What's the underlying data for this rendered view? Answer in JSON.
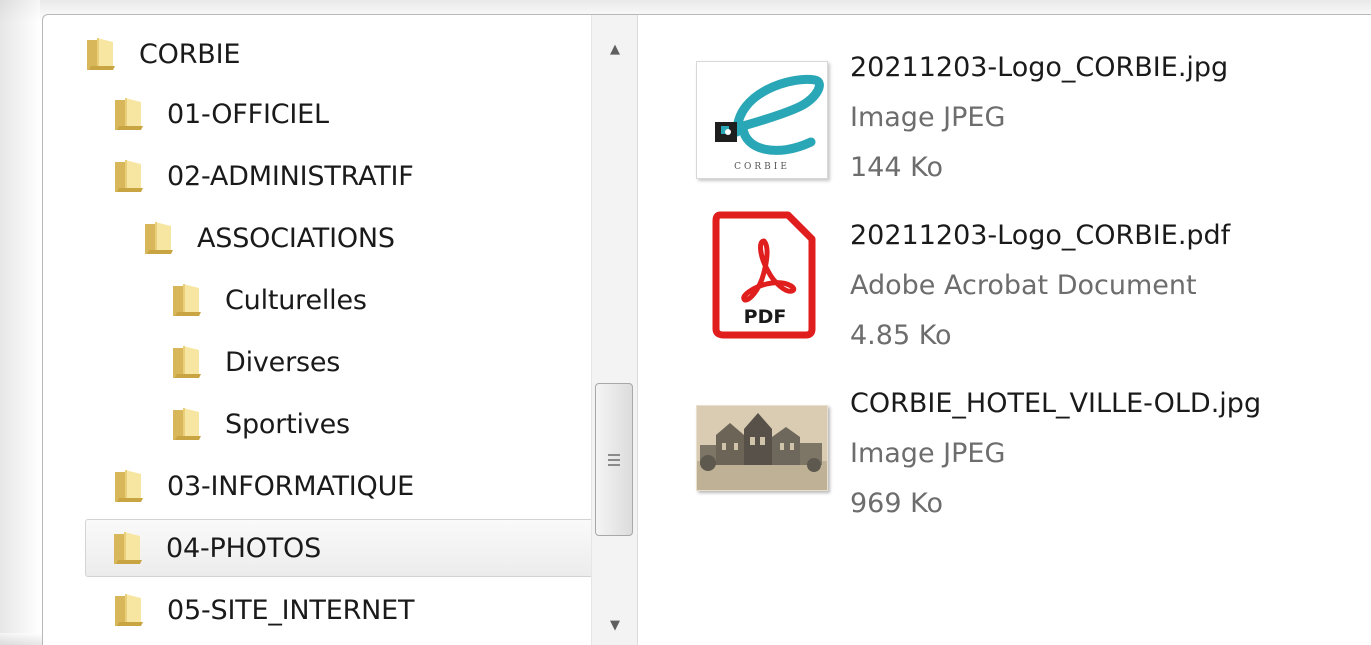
{
  "tree": {
    "items": [
      {
        "label": "CORBIE"
      },
      {
        "label": "01-OFFICIEL"
      },
      {
        "label": "02-ADMINISTRATIF"
      },
      {
        "label": "ASSOCIATIONS"
      },
      {
        "label": "Culturelles"
      },
      {
        "label": "Diverses"
      },
      {
        "label": "Sportives"
      },
      {
        "label": "03-INFORMATIQUE"
      },
      {
        "label": "04-PHOTOS"
      },
      {
        "label": "05-SITE_INTERNET"
      }
    ],
    "selected": "04-PHOTOS"
  },
  "scrollbar": {
    "up_glyph": "▲",
    "down_glyph": "▼"
  },
  "files": [
    {
      "name": "20211203-Logo_CORBIE.jpg",
      "type": "Image JPEG",
      "size": "144 Ko",
      "thumb_icon": "corbie-logo-thumbnail",
      "logo_caption": "CORBIE"
    },
    {
      "name": "20211203-Logo_CORBIE.pdf",
      "type": "Adobe Acrobat Document",
      "size": "4.85 Ko",
      "thumb_icon": "pdf-file-icon",
      "pdf_label": "PDF"
    },
    {
      "name": "CORBIE_HOTEL_VILLE-OLD.jpg",
      "type": "Image JPEG",
      "size": "969 Ko",
      "thumb_icon": "old-photo-thumbnail"
    }
  ],
  "colors": {
    "folder_light": "#f7e6a1",
    "folder_dark": "#d8b75a",
    "pdf_red": "#e01e1e"
  }
}
